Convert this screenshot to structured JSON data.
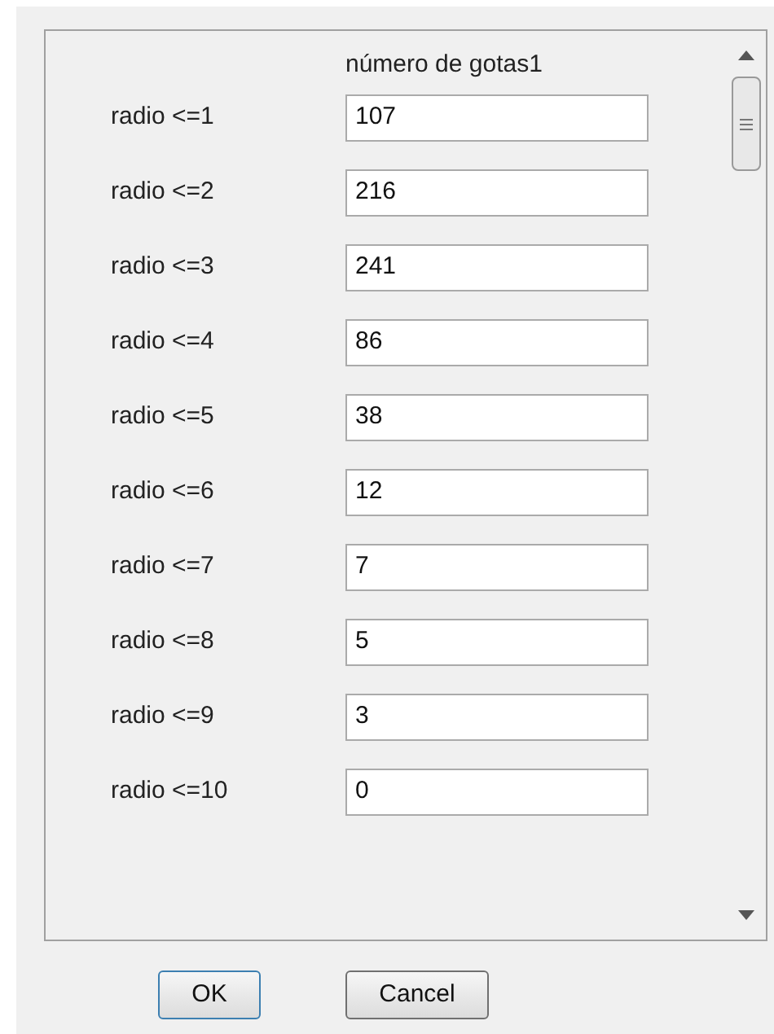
{
  "column_header": "número de gotas1",
  "rows": [
    {
      "label": "radio <=1",
      "value": "107"
    },
    {
      "label": "radio <=2",
      "value": "216"
    },
    {
      "label": "radio <=3",
      "value": "241"
    },
    {
      "label": "radio <=4",
      "value": "86"
    },
    {
      "label": "radio <=5",
      "value": "38"
    },
    {
      "label": "radio <=6",
      "value": "12"
    },
    {
      "label": "radio <=7",
      "value": "7"
    },
    {
      "label": "radio <=8",
      "value": "5"
    },
    {
      "label": "radio <=9",
      "value": "3"
    },
    {
      "label": "radio <=10",
      "value": "0"
    }
  ],
  "buttons": [
    {
      "label": "OK",
      "focused": true
    },
    {
      "label": "Cancel",
      "focused": false
    }
  ]
}
